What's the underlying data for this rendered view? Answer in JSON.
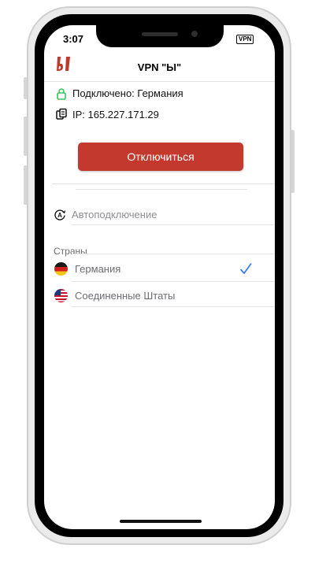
{
  "status_bar": {
    "time": "3:07",
    "vpn_badge": "VPN"
  },
  "nav": {
    "title": "VPN \"Ы\"",
    "logo_letter": "Ы",
    "logo_color": "#c0392b"
  },
  "connection": {
    "status_label": "Подключено: Германия",
    "ip_label": "IP: 165.227.171.29",
    "lock_color": "#34c759"
  },
  "actions": {
    "disconnect_label": "Отключиться",
    "button_color": "#c4392e"
  },
  "settings": {
    "auto_connect_label": "Автоподключение",
    "auto_connect_icon": "auto-a-icon"
  },
  "countries": {
    "header": "Страны",
    "items": [
      {
        "label": "Германия",
        "flag": "germany-flag-icon",
        "selected": true
      },
      {
        "label": "Соединенные Штаты",
        "flag": "usa-flag-icon",
        "selected": false
      }
    ],
    "check_color": "#3478f6"
  }
}
